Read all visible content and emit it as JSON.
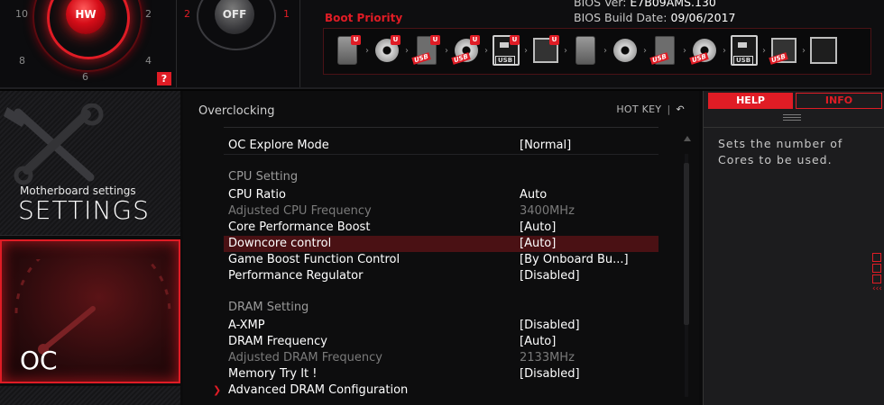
{
  "knob": {
    "label": "HW",
    "numbers": [
      "10",
      "2",
      "8",
      "4",
      "6"
    ]
  },
  "off_knob": {
    "label": "OFF",
    "left_num": "2",
    "right_num": "1"
  },
  "help_badge": "?",
  "bios": {
    "ver_label": "BIOS Ver:",
    "ver_value": "E7B09AMS.130",
    "date_label": "BIOS Build Date:",
    "date_value": "09/06/2017"
  },
  "boot_priority": {
    "label": "Boot Priority",
    "devices": [
      {
        "icon": "hdd-icon",
        "u": "U",
        "tag": ""
      },
      {
        "icon": "optical-disc-icon",
        "u": "U",
        "tag": ""
      },
      {
        "icon": "usb-hdd-icon",
        "u": "U",
        "tag": "USB"
      },
      {
        "icon": "usb-disc-icon",
        "u": "U",
        "tag": "USB"
      },
      {
        "icon": "usb-key-icon",
        "u": "U",
        "tag": "USB"
      },
      {
        "icon": "floppy-icon",
        "u": "U",
        "tag": ""
      },
      {
        "icon": "hdd-icon",
        "u": "",
        "tag": ""
      },
      {
        "icon": "optical-disc-icon",
        "u": "",
        "tag": ""
      },
      {
        "icon": "usb-hdd-icon",
        "u": "",
        "tag": "USB"
      },
      {
        "icon": "usb-disc-icon",
        "u": "",
        "tag": "USB"
      },
      {
        "icon": "usb-key-icon",
        "u": "",
        "tag": "USB"
      },
      {
        "icon": "usb-floppy-icon",
        "u": "",
        "tag": "USB"
      },
      {
        "icon": "network-icon",
        "u": "",
        "tag": ""
      }
    ]
  },
  "sidebar": {
    "settings_sub": "Motherboard settings",
    "settings_title": "SETTINGS",
    "oc_title": "OC"
  },
  "main": {
    "title": "Overclocking",
    "hotkey": "HOT KEY",
    "hotkey_sep": "|",
    "back_glyph": "↶"
  },
  "rows": [
    {
      "label": "OC Explore Mode",
      "value": "[Normal]",
      "state": "normal"
    },
    {
      "label": "CPU  Setting",
      "value": "",
      "state": "section"
    },
    {
      "label": "CPU Ratio",
      "value": "Auto",
      "state": "normal"
    },
    {
      "label": "Adjusted CPU Frequency",
      "value": "3400MHz",
      "state": "disabled"
    },
    {
      "label": "Core Performance Boost",
      "value": "[Auto]",
      "state": "normal"
    },
    {
      "label": "Downcore control",
      "value": "[Auto]",
      "state": "selected"
    },
    {
      "label": "Game Boost Function Control",
      "value": "[By Onboard Bu...]",
      "state": "normal"
    },
    {
      "label": "Performance Regulator",
      "value": "[Disabled]",
      "state": "normal"
    },
    {
      "label": "DRAM  Setting",
      "value": "",
      "state": "section"
    },
    {
      "label": "A-XMP",
      "value": "[Disabled]",
      "state": "normal"
    },
    {
      "label": "DRAM Frequency",
      "value": "[Auto]",
      "state": "normal"
    },
    {
      "label": "Adjusted DRAM Frequency",
      "value": "2133MHz",
      "state": "disabled"
    },
    {
      "label": "Memory Try It !",
      "value": "[Disabled]",
      "state": "normal"
    },
    {
      "label": "Advanced DRAM Configuration",
      "value": "",
      "state": "submenu"
    }
  ],
  "help": {
    "tab_help": "HELP",
    "tab_info": "INFO",
    "text": "Sets the number of Cores to be used."
  },
  "colors": {
    "accent": "#e01c25",
    "selected_row": "#4a1114",
    "background": "#0b0b0c"
  }
}
